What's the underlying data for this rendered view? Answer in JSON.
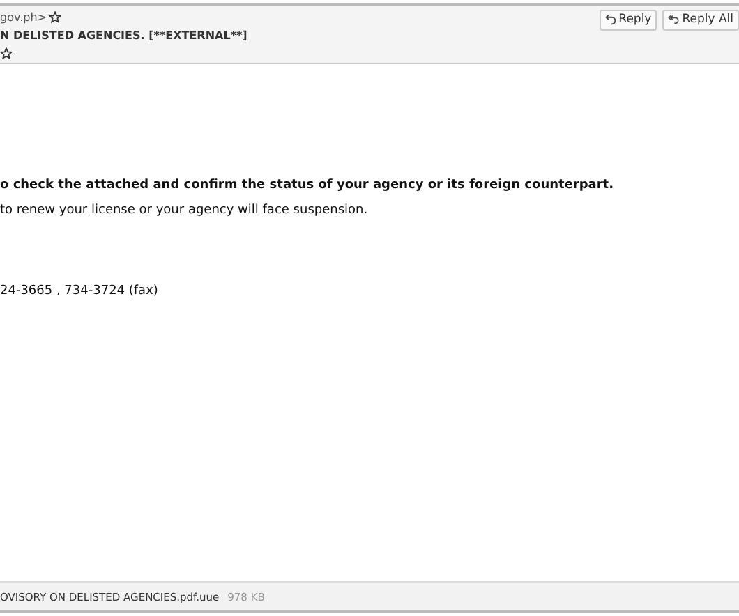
{
  "header": {
    "from": "gov.ph>",
    "subject": "N DELISTED AGENCIES. [**EXTERNAL**]",
    "buttons": [
      {
        "label": "Reply",
        "kind": "reply"
      },
      {
        "label": "Reply All",
        "kind": "reply-all"
      }
    ]
  },
  "body": [
    {
      "text": "o check the attached and confirm the status of your agency or its foreign counterpart.",
      "bold": true
    },
    {
      "text": "to renew your license or your agency will face suspension.",
      "bold": false
    },
    {
      "text": "24-3665 , 734-3724 (fax)",
      "bold": false
    }
  ],
  "attachment": {
    "name": "OVISORY ON DELISTED AGENCIES.pdf.uue",
    "size": "978 KB"
  }
}
